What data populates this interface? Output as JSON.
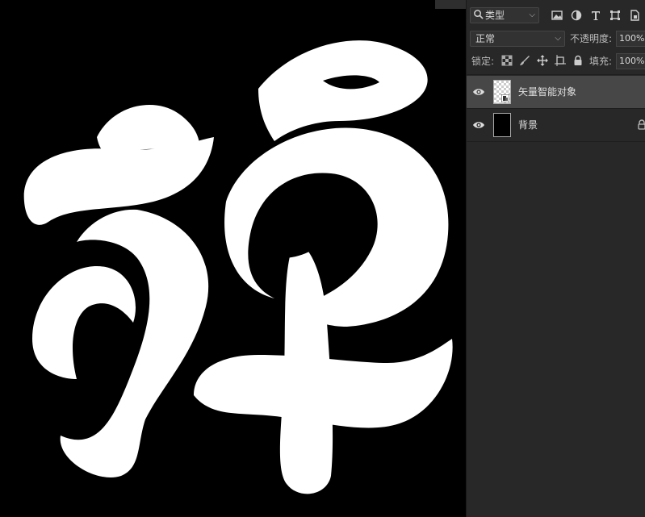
{
  "canvas": {
    "glyph": "弹"
  },
  "layers_panel": {
    "filter": {
      "kind": "类型"
    },
    "blend_mode": "正常",
    "opacity": {
      "label": "不透明度:",
      "value": "100%"
    },
    "lock": {
      "label": "锁定:"
    },
    "fill": {
      "label": "填充:",
      "value": "100%"
    },
    "layers": [
      {
        "name": "矢量智能对象",
        "type": "smart-object",
        "visible": true,
        "selected": true
      },
      {
        "name": "背景",
        "type": "background",
        "visible": true,
        "locked": true
      }
    ]
  },
  "icons": {
    "filter_search": "search-icon",
    "filter_image": "image-filter-icon",
    "filter_adjust": "adjustment-filter-icon",
    "filter_text": "text-filter-icon",
    "filter_shape": "shape-filter-icon",
    "filter_smart": "smart-object-filter-icon",
    "lock_pixels": "lock-transparent-pixels-icon",
    "lock_image": "lock-image-pixels-icon",
    "lock_position": "lock-position-icon",
    "lock_artboard": "lock-artboard-icon",
    "lock_all": "lock-all-icon"
  },
  "colors": {
    "canvas_bg": "#000000",
    "glyph": "#ffffff",
    "panel_bg": "#282828",
    "selected_row": "#474747"
  }
}
